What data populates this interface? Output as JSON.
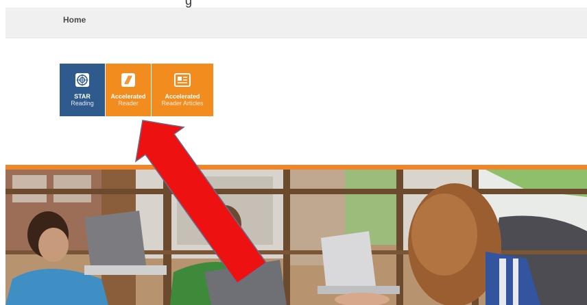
{
  "header": {
    "partial_text": "g",
    "home_label": "Home"
  },
  "tiles": [
    {
      "icon": "target-icon",
      "line1": "STAR",
      "line2": "Reading",
      "color": "#2f5a8e"
    },
    {
      "icon": "book-icon",
      "line1": "Accelerated",
      "line2": "Reader",
      "color": "#f28c1e"
    },
    {
      "icon": "newspaper-icon",
      "line1": "Accelerated",
      "line2": "Reader Articles",
      "color": "#f28c1e"
    }
  ],
  "colors": {
    "accent_orange": "#f0852a",
    "navy": "#2f5a8e",
    "annotation_arrow": "#ee1111"
  },
  "hero": {
    "description_icon": "classroom-photo"
  }
}
